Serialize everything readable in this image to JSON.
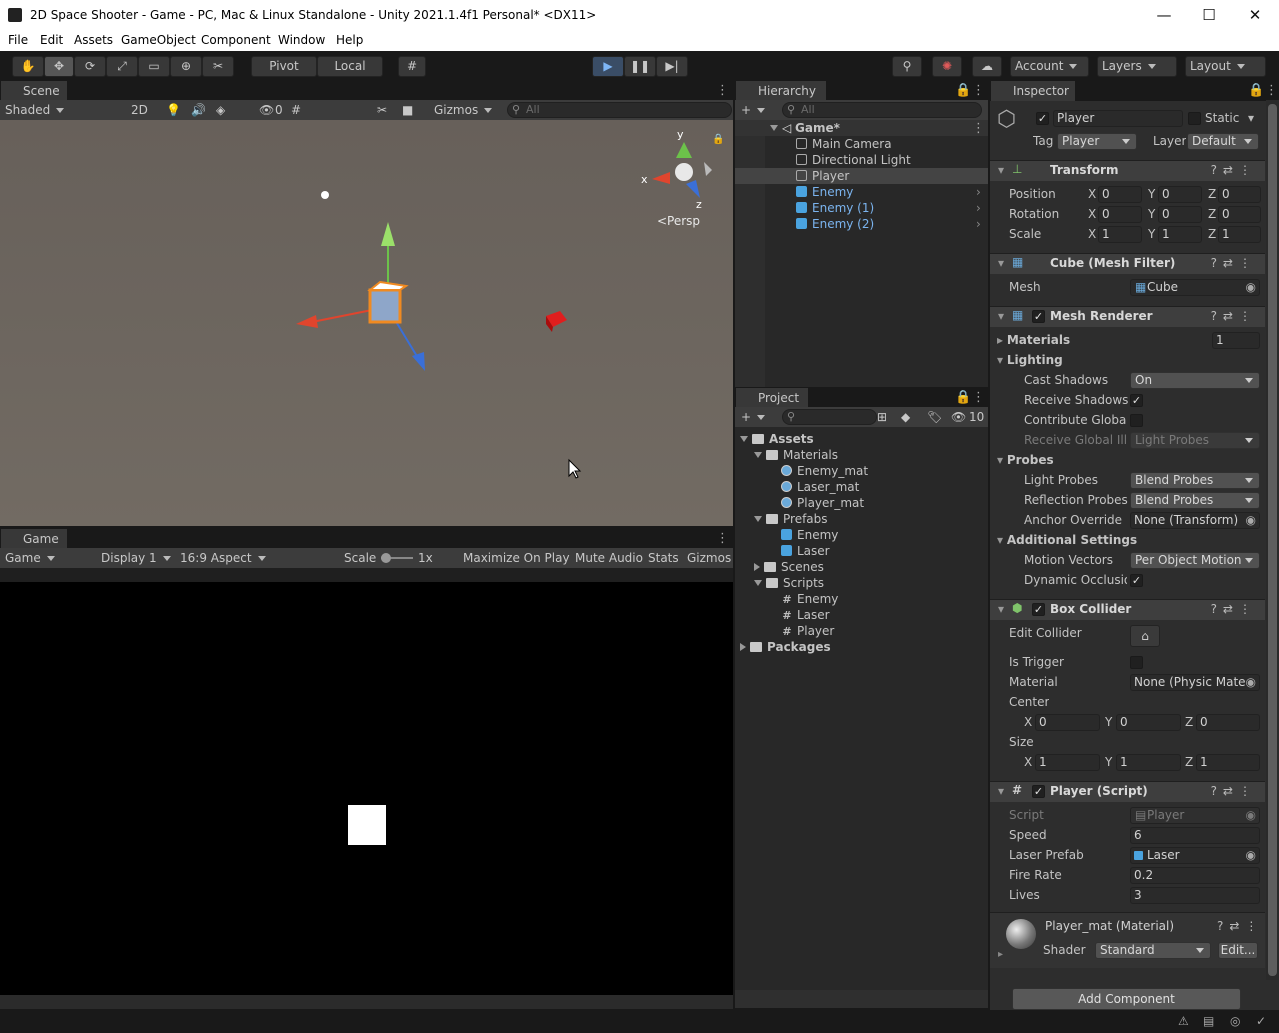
{
  "window": {
    "title": "2D Space Shooter - Game - PC, Mac & Linux Standalone - Unity 2021.1.4f1 Personal* <DX11>",
    "minimize": "—",
    "maximize": "☐",
    "close": "✕"
  },
  "menu": [
    "File",
    "Edit",
    "Assets",
    "GameObject",
    "Component",
    "Window",
    "Help"
  ],
  "toolbar": {
    "pivot": "Pivot",
    "local": "Local",
    "account": "Account",
    "layers": "Layers",
    "layout": "Layout"
  },
  "scene": {
    "tab": "Scene",
    "shading": "Shaded",
    "mode2d": "2D",
    "hidden_count": "0",
    "gizmos": "Gizmos",
    "search_placeholder": "All",
    "persp": "<Persp",
    "axis_x": "x",
    "axis_y": "y",
    "axis_z": "z"
  },
  "game": {
    "tab": "Game",
    "view": "Game",
    "display": "Display 1",
    "aspect": "16:9 Aspect",
    "scale_label": "Scale",
    "scale_value": "1x",
    "maximize": "Maximize On Play",
    "mute": "Mute Audio",
    "stats": "Stats",
    "gizmos": "Gizmos"
  },
  "hierarchy": {
    "tab": "Hierarchy",
    "search_placeholder": "All",
    "scene": "Game*",
    "items": [
      {
        "label": "Main Camera",
        "prefab": false
      },
      {
        "label": "Directional Light",
        "prefab": false
      },
      {
        "label": "Player",
        "prefab": false
      },
      {
        "label": "Enemy",
        "prefab": true
      },
      {
        "label": "Enemy (1)",
        "prefab": true
      },
      {
        "label": "Enemy (2)",
        "prefab": true
      }
    ]
  },
  "project": {
    "tab": "Project",
    "hidden_count": "10",
    "assets": "Assets",
    "materials": "Materials",
    "mat1": "Enemy_mat",
    "mat2": "Laser_mat",
    "mat3": "Player_mat",
    "prefabs": "Prefabs",
    "pf1": "Enemy",
    "pf2": "Laser",
    "scenes": "Scenes",
    "scripts": "Scripts",
    "sc1": "Enemy",
    "sc2": "Laser",
    "sc3": "Player",
    "packages": "Packages"
  },
  "inspector": {
    "tab": "Inspector",
    "name": "Player",
    "static": "Static",
    "tag_label": "Tag",
    "tag": "Player",
    "layer_label": "Layer",
    "layer": "Default",
    "transform": {
      "title": "Transform",
      "position": "Position",
      "rotation": "Rotation",
      "scale": "Scale",
      "pos": [
        "0",
        "0",
        "0"
      ],
      "rot": [
        "0",
        "0",
        "0"
      ],
      "scl": [
        "1",
        "1",
        "1"
      ]
    },
    "meshfilter": {
      "title": "Cube (Mesh Filter)",
      "mesh_label": "Mesh",
      "mesh": "Cube"
    },
    "meshrenderer": {
      "title": "Mesh Renderer",
      "materials": "Materials",
      "materials_count": "1",
      "lighting": "Lighting",
      "cast_shadows": "Cast Shadows",
      "cast_shadows_val": "On",
      "receive_shadows": "Receive Shadows",
      "contribute_gi": "Contribute Global I",
      "receive_gi": "Receive Global Illu",
      "receive_gi_val": "Light Probes",
      "probes": "Probes",
      "light_probes": "Light Probes",
      "light_probes_val": "Blend Probes",
      "reflection_probes": "Reflection Probes",
      "reflection_probes_val": "Blend Probes",
      "anchor_override": "Anchor Override",
      "anchor_override_val": "None (Transform)",
      "additional": "Additional Settings",
      "motion_vectors": "Motion Vectors",
      "motion_vectors_val": "Per Object Motion",
      "dynamic_occlusion": "Dynamic Occlusio"
    },
    "boxcollider": {
      "title": "Box Collider",
      "edit_collider": "Edit Collider",
      "is_trigger": "Is Trigger",
      "material": "Material",
      "material_val": "None (Physic Mater",
      "center": "Center",
      "center_vals": [
        "0",
        "0",
        "0"
      ],
      "size": "Size",
      "size_vals": [
        "1",
        "1",
        "1"
      ]
    },
    "script": {
      "title": "Player (Script)",
      "script_label": "Script",
      "script_val": "Player",
      "speed_label": "Speed",
      "speed": "6",
      "laser_label": "Laser Prefab",
      "laser": "Laser",
      "fire_label": "Fire Rate",
      "fire": "0.2",
      "lives_label": "Lives",
      "lives": "3"
    },
    "material": {
      "title": "Player_mat (Material)",
      "shader_label": "Shader",
      "shader": "Standard",
      "edit": "Edit..."
    },
    "add_component": "Add Component"
  },
  "colors": {
    "accent_blue": "#3a79bb",
    "prefab_blue": "#7bb4ef",
    "panel_bg": "#282828",
    "scene_bg": "#6b6258"
  }
}
